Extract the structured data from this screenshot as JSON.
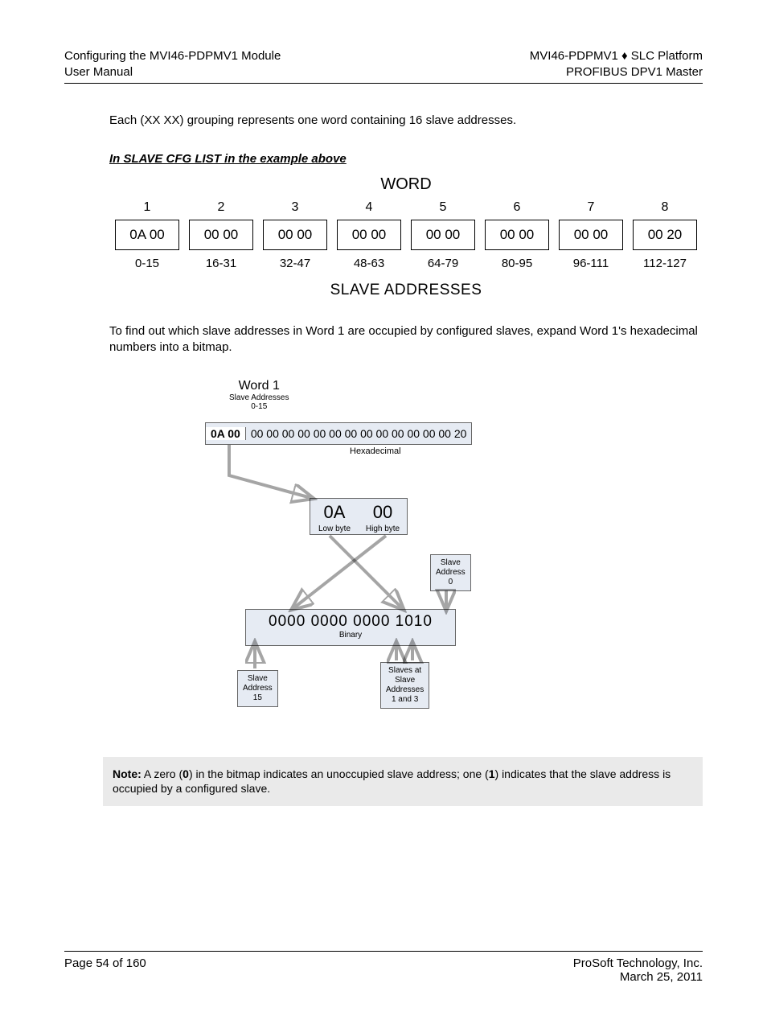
{
  "header": {
    "leftLine1": "Configuring the MVI46-PDPMV1 Module",
    "leftLine2": "User Manual",
    "rightLine1": "MVI46-PDPMV1 ♦ SLC Platform",
    "rightLine2": "PROFIBUS DPV1 Master"
  },
  "para1": "Each (XX XX) grouping represents one word containing 16 slave addresses.",
  "heading1": "In SLAVE CFG LIST in the example above",
  "wordDiagram": {
    "title": "WORD",
    "columns": [
      {
        "num": "1",
        "cell": "0A 00",
        "addr": "0-15"
      },
      {
        "num": "2",
        "cell": "00 00",
        "addr": "16-31"
      },
      {
        "num": "3",
        "cell": "00 00",
        "addr": "32-47"
      },
      {
        "num": "4",
        "cell": "00 00",
        "addr": "48-63"
      },
      {
        "num": "5",
        "cell": "00 00",
        "addr": "64-79"
      },
      {
        "num": "6",
        "cell": "00 00",
        "addr": "80-95"
      },
      {
        "num": "7",
        "cell": "00 00",
        "addr": "96-111"
      },
      {
        "num": "8",
        "cell": "00 20",
        "addr": "112-127"
      }
    ],
    "caption": "SLAVE ADDRESSES"
  },
  "para2": "To find out which slave addresses in Word 1 are occupied by configured slaves, expand Word 1's hexadecimal numbers into a bitmap.",
  "diagram2": {
    "word1Title": "Word 1",
    "word1Sub1": "Slave Addresses",
    "word1Sub2": "0-15",
    "hexFirst": "0A 00",
    "hexRest": "00 00 00 00 00 00 00 00 00 00 00 00 00 20",
    "hexLabel": "Hexadecimal",
    "byteLow": "0A",
    "byteLowLbl": "Low byte",
    "byteHigh": "00",
    "byteHighLbl": "High byte",
    "slaveAddr0": "Slave\nAddress\n0",
    "binVal": "0000 0000 0000 1010",
    "binLbl": "Binary",
    "slaveAddr15": "Slave\nAddress\n15",
    "slaves13": "Slaves at\nSlave\nAddresses\n1 and 3"
  },
  "note": {
    "prefix": "Note:",
    "text1": " A zero (",
    "zero": "0",
    "text2": ") in the bitmap indicates an unoccupied slave address; one (",
    "one": "1",
    "text3": ") indicates that the slave address is occupied by a configured slave."
  },
  "footer": {
    "left": "Page 54 of 160",
    "right1": "ProSoft Technology, Inc.",
    "right2": "March 25, 2011"
  }
}
